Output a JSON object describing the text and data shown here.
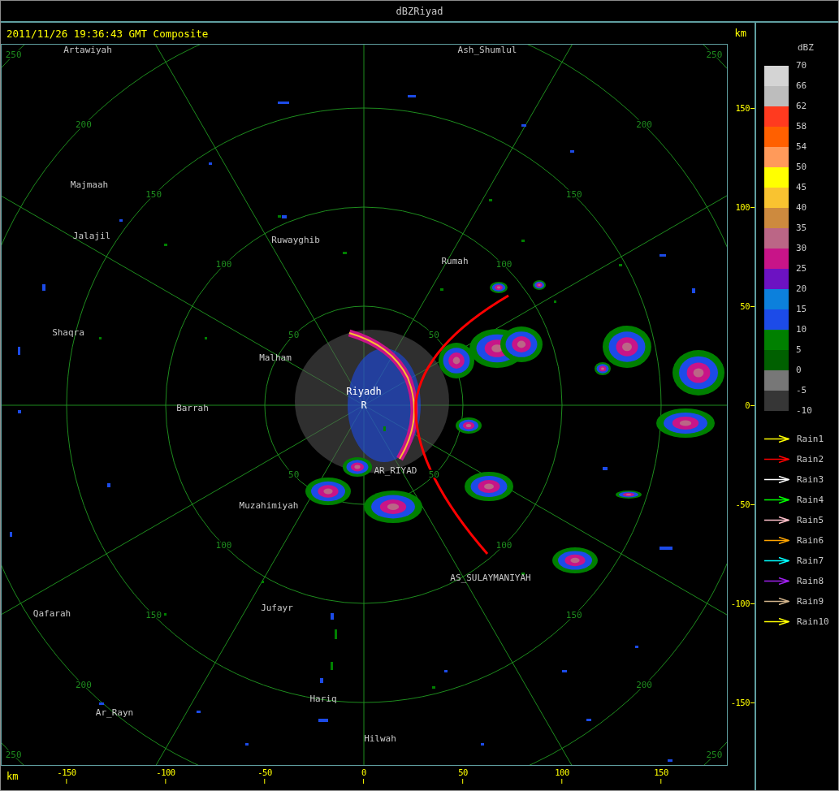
{
  "window": {
    "title": "dBZRiyad"
  },
  "header": {
    "timestamp": "2011/11/26 19:36:43 GMT Composite",
    "axis_unit": "km"
  },
  "map": {
    "radar_site": {
      "name": "Riyadh",
      "marker": "R"
    },
    "places": [
      {
        "name": "Artawiyah"
      },
      {
        "name": "Ash_Shumlul"
      },
      {
        "name": "Majmaah"
      },
      {
        "name": "Jalajil"
      },
      {
        "name": "Ruwayghib"
      },
      {
        "name": "Rumah"
      },
      {
        "name": "Shaqra"
      },
      {
        "name": "Malham"
      },
      {
        "name": "Barrah"
      },
      {
        "name": "AR_RIYAD"
      },
      {
        "name": "Muzahimiyah"
      },
      {
        "name": "AS_SULAYMANIYAH"
      },
      {
        "name": "Jufayr"
      },
      {
        "name": "Qafarah"
      },
      {
        "name": "Hariq"
      },
      {
        "name": "Ar_Rayn"
      },
      {
        "name": "Hilwah"
      }
    ],
    "range_rings": [
      {
        "labels": [
          "50",
          "50",
          "50",
          "50"
        ]
      },
      {
        "labels": [
          "100",
          "100",
          "100",
          "100"
        ]
      },
      {
        "labels": [
          "150",
          "150",
          "150",
          "150"
        ]
      },
      {
        "labels": [
          "200",
          "200",
          "200",
          "200"
        ]
      },
      {
        "labels": [
          "250",
          "250",
          "250",
          "250"
        ]
      }
    ]
  },
  "right_axis": {
    "ticks": [
      "150",
      "100",
      "50",
      "0",
      "-50",
      "-100",
      "-150"
    ]
  },
  "bottom_axis": {
    "unit": "km",
    "ticks": [
      "-150",
      "-100",
      "-50",
      "0",
      "50",
      "100",
      "150"
    ]
  },
  "legend": {
    "title": "dBZ",
    "bands": [
      {
        "label": "70",
        "color": "#d4d4d4"
      },
      {
        "label": "66",
        "color": "#bdbdbd"
      },
      {
        "label": "62",
        "color": "#ff3a1f"
      },
      {
        "label": "58",
        "color": "#ff6000"
      },
      {
        "label": "54",
        "color": "#ff9a5a"
      },
      {
        "label": "50",
        "color": "#ffff00"
      },
      {
        "label": "45",
        "color": "#f9c330"
      },
      {
        "label": "40",
        "color": "#cd8a3e"
      },
      {
        "label": "35",
        "color": "#bb6686"
      },
      {
        "label": "30",
        "color": "#c81488"
      },
      {
        "label": "25",
        "color": "#6c12c2"
      },
      {
        "label": "20",
        "color": "#0c80dc"
      },
      {
        "label": "15",
        "color": "#1c4be8"
      },
      {
        "label": "10",
        "color": "#008000"
      },
      {
        "label": "5",
        "color": "#006000"
      },
      {
        "label": "0",
        "color": "#777777"
      },
      {
        "label": "-5",
        "color": "#363636"
      }
    ],
    "bottom_label": "-10",
    "tracks": [
      {
        "name": "Rain1",
        "color": "#ffff00"
      },
      {
        "name": "Rain2",
        "color": "#ff0000"
      },
      {
        "name": "Rain3",
        "color": "#ffffff"
      },
      {
        "name": "Rain4",
        "color": "#00ff00"
      },
      {
        "name": "Rain5",
        "color": "#ffc0cb"
      },
      {
        "name": "Rain6",
        "color": "#ffa500"
      },
      {
        "name": "Rain7",
        "color": "#00ffff"
      },
      {
        "name": "Rain8",
        "color": "#a020f0"
      },
      {
        "name": "Rain9",
        "color": "#d2b48c"
      },
      {
        "name": "Rain10",
        "color": "#ffff00"
      }
    ]
  }
}
